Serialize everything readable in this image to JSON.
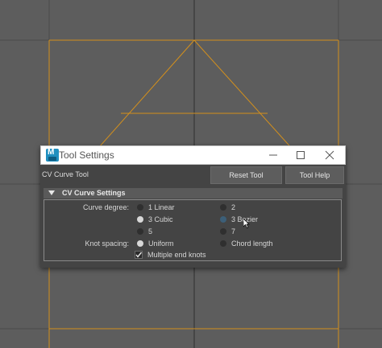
{
  "window": {
    "title": "Tool Settings",
    "logo_letter": "M"
  },
  "header": {
    "tool_name": "CV Curve Tool",
    "reset_label": "Reset Tool",
    "help_label": "Tool Help"
  },
  "section": {
    "title": "CV Curve Settings",
    "expanded": true
  },
  "curve_degree": {
    "label": "Curve degree:",
    "options": [
      "1 Linear",
      "2",
      "3 Cubic",
      "3 Bezier",
      "5",
      "7"
    ],
    "selected": "3 Cubic",
    "hovered": "3 Bezier"
  },
  "knot_spacing": {
    "label": "Knot spacing:",
    "options": [
      "Uniform",
      "Chord length"
    ],
    "selected": "Uniform"
  },
  "end_knots": {
    "label": "Multiple end knots",
    "checked": true
  },
  "colors": {
    "viewport_bg": "#5d5d5d",
    "grid_line": "#4a4a4a",
    "curve": "#d4901c",
    "window_bg": "#444444",
    "title_bar": "#ffffff",
    "logo": "#1f8fbf"
  },
  "icons": [
    "maya-logo-icon",
    "minimize-icon",
    "maximize-icon",
    "close-icon",
    "collapse-arrow-icon",
    "check-icon",
    "mouse-cursor-icon"
  ]
}
